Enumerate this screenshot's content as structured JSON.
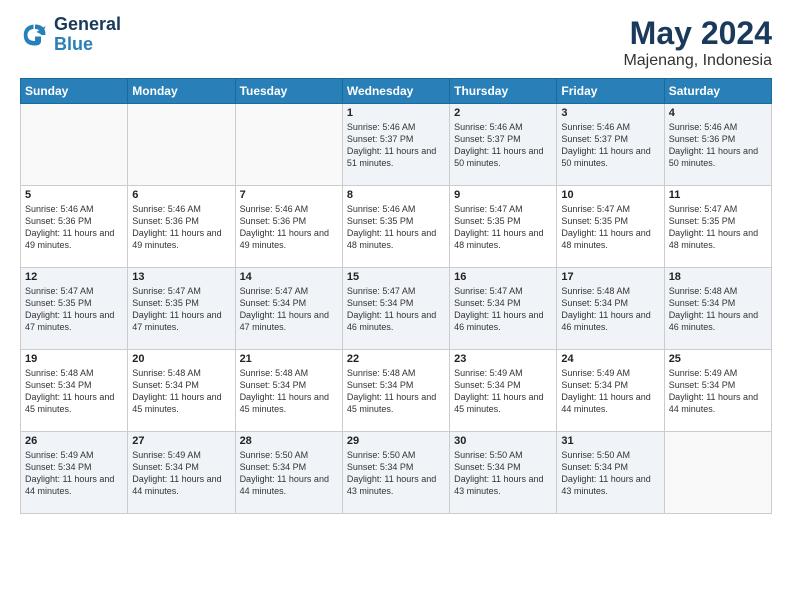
{
  "header": {
    "logo_line1": "General",
    "logo_line2": "Blue",
    "title": "May 2024",
    "subtitle": "Majenang, Indonesia"
  },
  "weekdays": [
    "Sunday",
    "Monday",
    "Tuesday",
    "Wednesday",
    "Thursday",
    "Friday",
    "Saturday"
  ],
  "weeks": [
    [
      {
        "day": "",
        "sunrise": "",
        "sunset": "",
        "daylight": ""
      },
      {
        "day": "",
        "sunrise": "",
        "sunset": "",
        "daylight": ""
      },
      {
        "day": "",
        "sunrise": "",
        "sunset": "",
        "daylight": ""
      },
      {
        "day": "1",
        "sunrise": "Sunrise: 5:46 AM",
        "sunset": "Sunset: 5:37 PM",
        "daylight": "Daylight: 11 hours and 51 minutes."
      },
      {
        "day": "2",
        "sunrise": "Sunrise: 5:46 AM",
        "sunset": "Sunset: 5:37 PM",
        "daylight": "Daylight: 11 hours and 50 minutes."
      },
      {
        "day": "3",
        "sunrise": "Sunrise: 5:46 AM",
        "sunset": "Sunset: 5:37 PM",
        "daylight": "Daylight: 11 hours and 50 minutes."
      },
      {
        "day": "4",
        "sunrise": "Sunrise: 5:46 AM",
        "sunset": "Sunset: 5:36 PM",
        "daylight": "Daylight: 11 hours and 50 minutes."
      }
    ],
    [
      {
        "day": "5",
        "sunrise": "Sunrise: 5:46 AM",
        "sunset": "Sunset: 5:36 PM",
        "daylight": "Daylight: 11 hours and 49 minutes."
      },
      {
        "day": "6",
        "sunrise": "Sunrise: 5:46 AM",
        "sunset": "Sunset: 5:36 PM",
        "daylight": "Daylight: 11 hours and 49 minutes."
      },
      {
        "day": "7",
        "sunrise": "Sunrise: 5:46 AM",
        "sunset": "Sunset: 5:36 PM",
        "daylight": "Daylight: 11 hours and 49 minutes."
      },
      {
        "day": "8",
        "sunrise": "Sunrise: 5:46 AM",
        "sunset": "Sunset: 5:35 PM",
        "daylight": "Daylight: 11 hours and 48 minutes."
      },
      {
        "day": "9",
        "sunrise": "Sunrise: 5:47 AM",
        "sunset": "Sunset: 5:35 PM",
        "daylight": "Daylight: 11 hours and 48 minutes."
      },
      {
        "day": "10",
        "sunrise": "Sunrise: 5:47 AM",
        "sunset": "Sunset: 5:35 PM",
        "daylight": "Daylight: 11 hours and 48 minutes."
      },
      {
        "day": "11",
        "sunrise": "Sunrise: 5:47 AM",
        "sunset": "Sunset: 5:35 PM",
        "daylight": "Daylight: 11 hours and 48 minutes."
      }
    ],
    [
      {
        "day": "12",
        "sunrise": "Sunrise: 5:47 AM",
        "sunset": "Sunset: 5:35 PM",
        "daylight": "Daylight: 11 hours and 47 minutes."
      },
      {
        "day": "13",
        "sunrise": "Sunrise: 5:47 AM",
        "sunset": "Sunset: 5:35 PM",
        "daylight": "Daylight: 11 hours and 47 minutes."
      },
      {
        "day": "14",
        "sunrise": "Sunrise: 5:47 AM",
        "sunset": "Sunset: 5:34 PM",
        "daylight": "Daylight: 11 hours and 47 minutes."
      },
      {
        "day": "15",
        "sunrise": "Sunrise: 5:47 AM",
        "sunset": "Sunset: 5:34 PM",
        "daylight": "Daylight: 11 hours and 46 minutes."
      },
      {
        "day": "16",
        "sunrise": "Sunrise: 5:47 AM",
        "sunset": "Sunset: 5:34 PM",
        "daylight": "Daylight: 11 hours and 46 minutes."
      },
      {
        "day": "17",
        "sunrise": "Sunrise: 5:48 AM",
        "sunset": "Sunset: 5:34 PM",
        "daylight": "Daylight: 11 hours and 46 minutes."
      },
      {
        "day": "18",
        "sunrise": "Sunrise: 5:48 AM",
        "sunset": "Sunset: 5:34 PM",
        "daylight": "Daylight: 11 hours and 46 minutes."
      }
    ],
    [
      {
        "day": "19",
        "sunrise": "Sunrise: 5:48 AM",
        "sunset": "Sunset: 5:34 PM",
        "daylight": "Daylight: 11 hours and 45 minutes."
      },
      {
        "day": "20",
        "sunrise": "Sunrise: 5:48 AM",
        "sunset": "Sunset: 5:34 PM",
        "daylight": "Daylight: 11 hours and 45 minutes."
      },
      {
        "day": "21",
        "sunrise": "Sunrise: 5:48 AM",
        "sunset": "Sunset: 5:34 PM",
        "daylight": "Daylight: 11 hours and 45 minutes."
      },
      {
        "day": "22",
        "sunrise": "Sunrise: 5:48 AM",
        "sunset": "Sunset: 5:34 PM",
        "daylight": "Daylight: 11 hours and 45 minutes."
      },
      {
        "day": "23",
        "sunrise": "Sunrise: 5:49 AM",
        "sunset": "Sunset: 5:34 PM",
        "daylight": "Daylight: 11 hours and 45 minutes."
      },
      {
        "day": "24",
        "sunrise": "Sunrise: 5:49 AM",
        "sunset": "Sunset: 5:34 PM",
        "daylight": "Daylight: 11 hours and 44 minutes."
      },
      {
        "day": "25",
        "sunrise": "Sunrise: 5:49 AM",
        "sunset": "Sunset: 5:34 PM",
        "daylight": "Daylight: 11 hours and 44 minutes."
      }
    ],
    [
      {
        "day": "26",
        "sunrise": "Sunrise: 5:49 AM",
        "sunset": "Sunset: 5:34 PM",
        "daylight": "Daylight: 11 hours and 44 minutes."
      },
      {
        "day": "27",
        "sunrise": "Sunrise: 5:49 AM",
        "sunset": "Sunset: 5:34 PM",
        "daylight": "Daylight: 11 hours and 44 minutes."
      },
      {
        "day": "28",
        "sunrise": "Sunrise: 5:50 AM",
        "sunset": "Sunset: 5:34 PM",
        "daylight": "Daylight: 11 hours and 44 minutes."
      },
      {
        "day": "29",
        "sunrise": "Sunrise: 5:50 AM",
        "sunset": "Sunset: 5:34 PM",
        "daylight": "Daylight: 11 hours and 43 minutes."
      },
      {
        "day": "30",
        "sunrise": "Sunrise: 5:50 AM",
        "sunset": "Sunset: 5:34 PM",
        "daylight": "Daylight: 11 hours and 43 minutes."
      },
      {
        "day": "31",
        "sunrise": "Sunrise: 5:50 AM",
        "sunset": "Sunset: 5:34 PM",
        "daylight": "Daylight: 11 hours and 43 minutes."
      },
      {
        "day": "",
        "sunrise": "",
        "sunset": "",
        "daylight": ""
      }
    ]
  ]
}
